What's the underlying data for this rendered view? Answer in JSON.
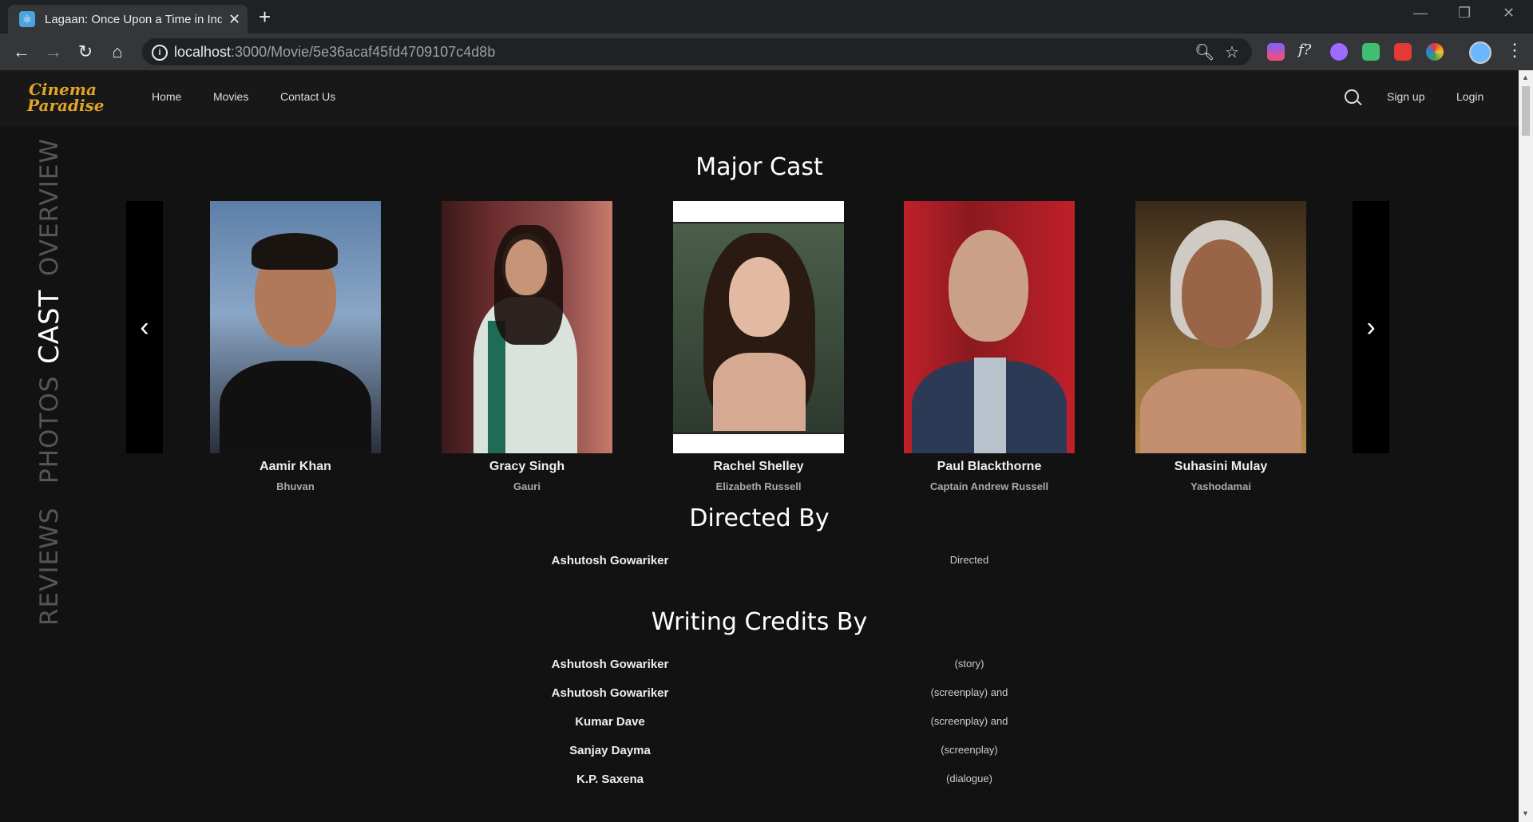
{
  "browser": {
    "tab_title": "Lagaan: Once Upon a Time in Ind",
    "url_host": "localhost",
    "url_path": ":3000/Movie/5e36acaf45fd4709107c4d8b"
  },
  "site": {
    "logo_line1": "Cinema",
    "logo_line2": "Paradise",
    "nav": [
      "Home",
      "Movies",
      "Contact Us"
    ],
    "signup": "Sign up",
    "login": "Login"
  },
  "side_tabs": [
    "OVERVIEW",
    "CAST",
    "PHOTOS",
    "REVIEWS"
  ],
  "active_side_tab": "CAST",
  "cast_section": {
    "title": "Major Cast",
    "cast": [
      {
        "name": "Aamir Khan",
        "role": "Bhuvan"
      },
      {
        "name": "Gracy Singh",
        "role": "Gauri"
      },
      {
        "name": "Rachel Shelley",
        "role": "Elizabeth Russell"
      },
      {
        "name": "Paul Blackthorne",
        "role": "Captain Andrew Russell"
      },
      {
        "name": "Suhasini Mulay",
        "role": "Yashodamai"
      }
    ]
  },
  "directed_section": {
    "title": "Directed By",
    "credits": [
      {
        "name": "Ashutosh Gowariker",
        "role": "Directed"
      }
    ]
  },
  "writing_section": {
    "title": "Writing Credits By",
    "credits": [
      {
        "name": "Ashutosh Gowariker",
        "role": "(story)"
      },
      {
        "name": "Ashutosh Gowariker",
        "role": "(screenplay) and"
      },
      {
        "name": "Kumar Dave",
        "role": "(screenplay) and"
      },
      {
        "name": "Sanjay Dayma",
        "role": "(screenplay)"
      },
      {
        "name": "K.P. Saxena",
        "role": "(dialogue)"
      }
    ]
  },
  "colors": {
    "background": "#121212",
    "logo": "#e0a526",
    "active_tab": "#ffffff",
    "inactive_tab": "#555555"
  }
}
